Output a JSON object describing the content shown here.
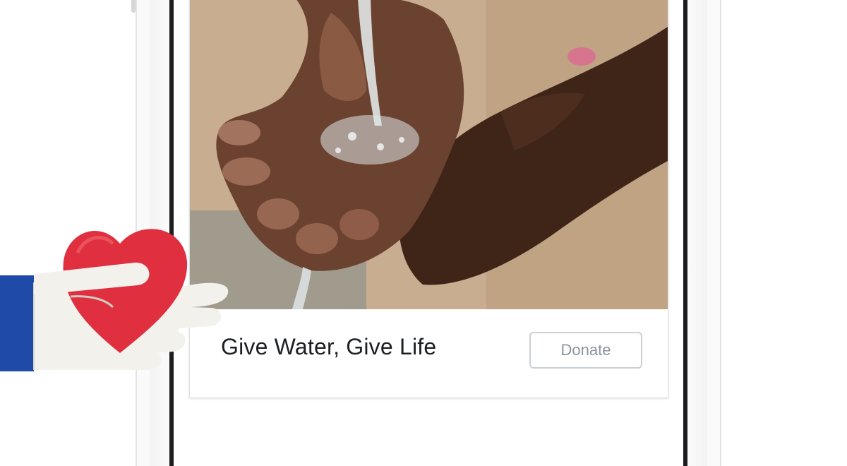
{
  "card": {
    "title": "Give Water, Give Life",
    "donate_label": "Donate"
  },
  "colors": {
    "heart": "#e02f3e",
    "sleeve": "#1f4aa8",
    "hand": "#f2f1ec",
    "button_border": "#ccd0d5",
    "button_text": "#8d949e",
    "title_text": "#1c1e21"
  },
  "icons": {
    "overlay": "hand-holding-heart-icon"
  }
}
